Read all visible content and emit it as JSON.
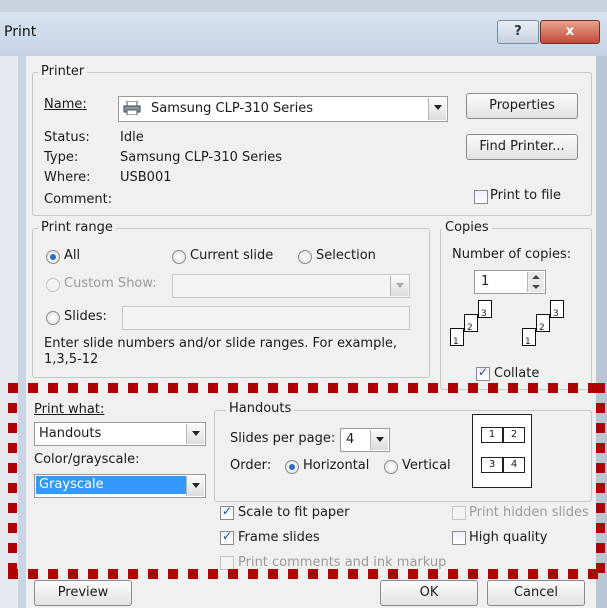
{
  "window": {
    "title": "Print",
    "help_icon": "?",
    "close_icon": "x"
  },
  "printer": {
    "group_label": "Printer",
    "name_label": "Name:",
    "name_value": "Samsung CLP-310 Series",
    "status_label": "Status:",
    "status_value": "Idle",
    "type_label": "Type:",
    "type_value": "Samsung CLP-310 Series",
    "where_label": "Where:",
    "where_value": "USB001",
    "comment_label": "Comment:",
    "properties_button": "Properties",
    "find_printer_button": "Find Printer...",
    "print_to_file_label": "Print to file"
  },
  "print_range": {
    "group_label": "Print range",
    "all_label": "All",
    "current_slide_label": "Current slide",
    "selection_label": "Selection",
    "custom_show_label": "Custom Show:",
    "slides_label": "Slides:",
    "hint_line1": "Enter slide numbers and/or slide ranges. For example,",
    "hint_line2": "1,3,5-12"
  },
  "copies": {
    "group_label": "Copies",
    "number_label": "Number of copies:",
    "number_value": "1",
    "collate_label": "Collate",
    "collate_icon_pages": [
      "1",
      "2",
      "3",
      "1",
      "2",
      "3"
    ]
  },
  "print_what": {
    "label": "Print what:",
    "value": "Handouts",
    "color_label": "Color/grayscale:",
    "color_value": "Grayscale"
  },
  "handouts": {
    "group_label": "Handouts",
    "slides_per_page_label": "Slides per page:",
    "slides_per_page_value": "4",
    "order_label": "Order:",
    "horizontal_label": "Horizontal",
    "vertical_label": "Vertical",
    "preview_cells": [
      "1",
      "2",
      "3",
      "4"
    ]
  },
  "options": {
    "scale_to_fit": "Scale to fit paper",
    "frame_slides": "Frame slides",
    "print_comments": "Print comments and ink markup",
    "print_hidden": "Print hidden slides",
    "high_quality": "High quality"
  },
  "footer": {
    "preview_button": "Preview",
    "ok_button": "OK",
    "cancel_button": "Cancel"
  },
  "colors": {
    "highlight_dash": "#b10000",
    "title_bar": "#c5d4e6",
    "dialog_bg": "#f0f0f0",
    "selection_bg": "#3399ff"
  }
}
